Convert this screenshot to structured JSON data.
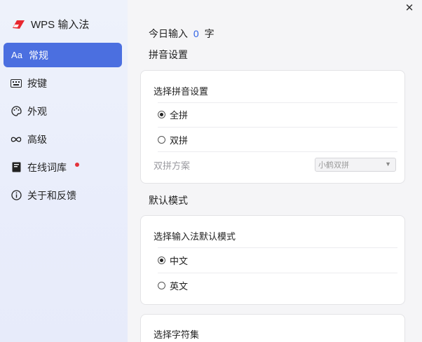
{
  "app": {
    "name": "WPS 输入法"
  },
  "nav": [
    {
      "label": "常规",
      "icon": "Aa"
    },
    {
      "label": "按键",
      "icon": "keyboard-icon"
    },
    {
      "label": "外观",
      "icon": "palette-icon"
    },
    {
      "label": "高级",
      "icon": "infinity-icon"
    },
    {
      "label": "在线词库",
      "icon": "book-icon"
    },
    {
      "label": "关于和反馈",
      "icon": "info-icon"
    }
  ],
  "today": {
    "prefix": "今日输入",
    "count": "0",
    "suffix": "字"
  },
  "pinyin": {
    "section_title": "拼音设置",
    "card_title": "选择拼音设置",
    "options": [
      "全拼",
      "双拼"
    ],
    "selected": "全拼",
    "shuangpin_label": "双拼方案",
    "shuangpin_value": "小鹤双拼"
  },
  "default_mode": {
    "section_title": "默认模式",
    "card_title": "选择输入法默认模式",
    "options": [
      "中文",
      "英文"
    ],
    "selected": "中文"
  },
  "charset": {
    "card_title": "选择字符集"
  },
  "colors": {
    "accent": "#4b6fe0",
    "count": "#2b5fe6",
    "notify_dot": "#e3323b"
  }
}
